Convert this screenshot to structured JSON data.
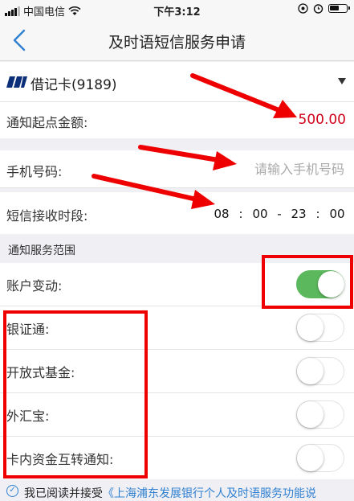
{
  "status_bar": {
    "carrier": "中国电信",
    "time": "下午3:12"
  },
  "nav": {
    "title": "及时语短信服务申请",
    "back_icon": "chevron-left-icon"
  },
  "card": {
    "label": "借记卡(9189)",
    "logo_icon": "bank-logo-icon"
  },
  "amount": {
    "label": "通知起点金额:",
    "value": "500.00"
  },
  "phone": {
    "label": "手机号码:",
    "placeholder": "请输入手机号码",
    "value": ""
  },
  "time_range": {
    "label": "短信接收时段:",
    "start_hour": "08",
    "start_min": "00",
    "end_hour": "23",
    "end_min": "00",
    "sep": ":",
    "dash": "-"
  },
  "scope": {
    "header": "通知服务范围",
    "items": [
      {
        "label": "账户变动:",
        "on": true
      },
      {
        "label": "银证通:",
        "on": false
      },
      {
        "label": "开放式基金:",
        "on": false
      },
      {
        "label": "外汇宝:",
        "on": false
      },
      {
        "label": "卡内资金互转通知:",
        "on": false
      }
    ]
  },
  "agreement": {
    "prefix": "我已阅读并接受",
    "link": "《上海浦东发展银行个人及时语服务功能说"
  },
  "colors": {
    "accent": "#2f80d1",
    "amount": "#d0021b",
    "toggle_on": "#5cb85c",
    "annotation": "#e00000"
  }
}
